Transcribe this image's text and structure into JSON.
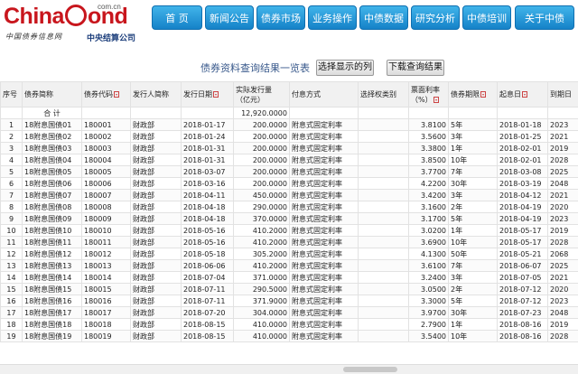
{
  "logo": {
    "brand_text_1": "China",
    "brand_text_2": "ond",
    "domain": "com.cn",
    "slogan": "中国债券信息网",
    "org": "中央结算公司"
  },
  "nav": [
    "首 页",
    "新闻公告",
    "债券市场",
    "业务操作",
    "中债数据",
    "研究分析",
    "中债培训",
    "关于中债"
  ],
  "toolbar": {
    "title": "债券资料查询结果一览表",
    "select_columns_label": "选择显示的列",
    "download_label": "下载查询结果"
  },
  "table": {
    "columns": [
      "序号",
      "债券简称",
      "债券代码",
      "发行人简称",
      "发行日期",
      "实际发行量\n（亿元）",
      "付息方式",
      "选择权类别",
      "票面利率\n（%）",
      "债券期限",
      "起息日",
      "到期日"
    ],
    "sortable": [
      false,
      false,
      true,
      false,
      true,
      false,
      false,
      false,
      true,
      true,
      true,
      false
    ],
    "total": {
      "label": "合 计",
      "amount": "12,920.0000"
    },
    "rows": [
      [
        "1",
        "18附息国债01",
        "180001",
        "财政部",
        "2018-01-17",
        "200.0000",
        "附息式固定利率",
        "",
        "3.8100",
        "5年",
        "2018-01-18",
        "2023"
      ],
      [
        "2",
        "18附息国债02",
        "180002",
        "财政部",
        "2018-01-24",
        "200.0000",
        "附息式固定利率",
        "",
        "3.5600",
        "3年",
        "2018-01-25",
        "2021"
      ],
      [
        "3",
        "18附息国债03",
        "180003",
        "财政部",
        "2018-01-31",
        "200.0000",
        "附息式固定利率",
        "",
        "3.3800",
        "1年",
        "2018-02-01",
        "2019"
      ],
      [
        "4",
        "18附息国债04",
        "180004",
        "财政部",
        "2018-01-31",
        "200.0000",
        "附息式固定利率",
        "",
        "3.8500",
        "10年",
        "2018-02-01",
        "2028"
      ],
      [
        "5",
        "18附息国债05",
        "180005",
        "财政部",
        "2018-03-07",
        "200.0000",
        "附息式固定利率",
        "",
        "3.7700",
        "7年",
        "2018-03-08",
        "2025"
      ],
      [
        "6",
        "18附息国债06",
        "180006",
        "财政部",
        "2018-03-16",
        "200.0000",
        "附息式固定利率",
        "",
        "4.2200",
        "30年",
        "2018-03-19",
        "2048"
      ],
      [
        "7",
        "18附息国债07",
        "180007",
        "财政部",
        "2018-04-11",
        "450.0000",
        "附息式固定利率",
        "",
        "3.4200",
        "3年",
        "2018-04-12",
        "2021"
      ],
      [
        "8",
        "18附息国债08",
        "180008",
        "财政部",
        "2018-04-18",
        "290.0000",
        "附息式固定利率",
        "",
        "3.1600",
        "2年",
        "2018-04-19",
        "2020"
      ],
      [
        "9",
        "18附息国债09",
        "180009",
        "财政部",
        "2018-04-18",
        "370.0000",
        "附息式固定利率",
        "",
        "3.1700",
        "5年",
        "2018-04-19",
        "2023"
      ],
      [
        "10",
        "18附息国债10",
        "180010",
        "财政部",
        "2018-05-16",
        "410.2000",
        "附息式固定利率",
        "",
        "3.0200",
        "1年",
        "2018-05-17",
        "2019"
      ],
      [
        "11",
        "18附息国债11",
        "180011",
        "财政部",
        "2018-05-16",
        "410.2000",
        "附息式固定利率",
        "",
        "3.6900",
        "10年",
        "2018-05-17",
        "2028"
      ],
      [
        "12",
        "18附息国债12",
        "180012",
        "财政部",
        "2018-05-18",
        "305.2000",
        "附息式固定利率",
        "",
        "4.1300",
        "50年",
        "2018-05-21",
        "2068"
      ],
      [
        "13",
        "18附息国债13",
        "180013",
        "财政部",
        "2018-06-06",
        "410.2000",
        "附息式固定利率",
        "",
        "3.6100",
        "7年",
        "2018-06-07",
        "2025"
      ],
      [
        "14",
        "18附息国债14",
        "180014",
        "财政部",
        "2018-07-04",
        "371.0000",
        "附息式固定利率",
        "",
        "3.2400",
        "3年",
        "2018-07-05",
        "2021"
      ],
      [
        "15",
        "18附息国债15",
        "180015",
        "财政部",
        "2018-07-11",
        "290.5000",
        "附息式固定利率",
        "",
        "3.0500",
        "2年",
        "2018-07-12",
        "2020"
      ],
      [
        "16",
        "18附息国债16",
        "180016",
        "财政部",
        "2018-07-11",
        "371.9000",
        "附息式固定利率",
        "",
        "3.3000",
        "5年",
        "2018-07-12",
        "2023"
      ],
      [
        "17",
        "18附息国债17",
        "180017",
        "财政部",
        "2018-07-20",
        "304.0000",
        "附息式固定利率",
        "",
        "3.9700",
        "30年",
        "2018-07-23",
        "2048"
      ],
      [
        "18",
        "18附息国债18",
        "180018",
        "财政部",
        "2018-08-15",
        "410.0000",
        "附息式固定利率",
        "",
        "2.7900",
        "1年",
        "2018-08-16",
        "2019"
      ],
      [
        "19",
        "18附息国债19",
        "180019",
        "财政部",
        "2018-08-15",
        "410.0000",
        "附息式固定利率",
        "",
        "3.5400",
        "10年",
        "2018-08-16",
        "2028"
      ]
    ]
  }
}
